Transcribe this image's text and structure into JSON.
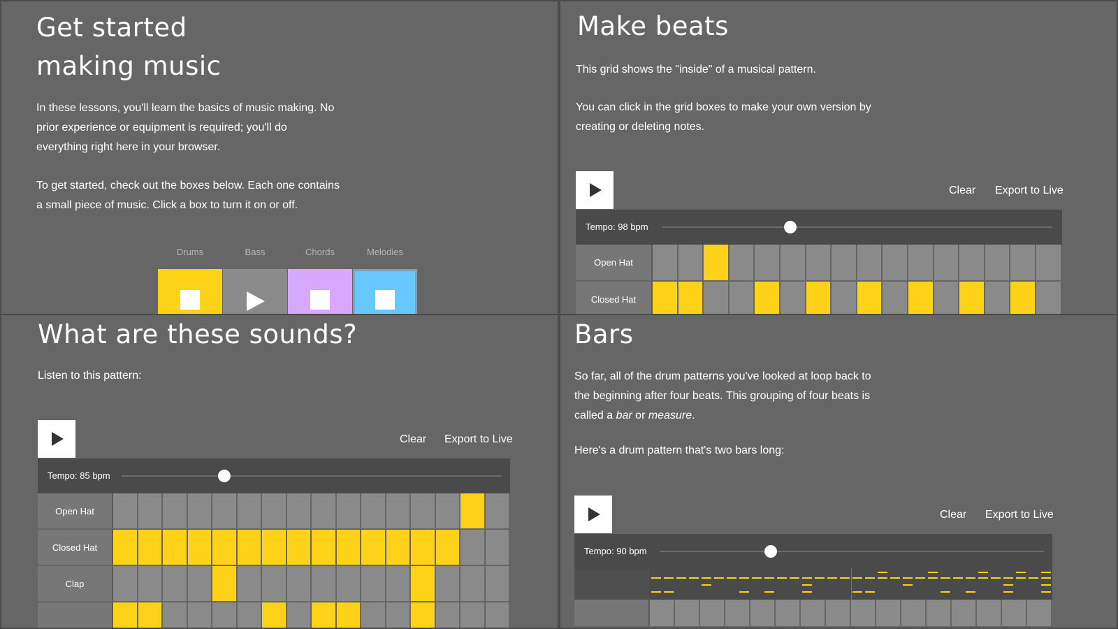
{
  "panel1": {
    "title_line1": "Get started",
    "title_line2": "making music",
    "para1_l1": "In these lessons, you'll learn the basics of music making. No",
    "para1_l2": "prior experience or equipment is required; you'll do",
    "para1_l3": "everything right here in your browser.",
    "para2_l1": "To get started, check out the boxes below. Each one contains",
    "para2_l2": "a small piece of music. Click a box to turn it on or off.",
    "instruments": [
      {
        "label": "Drums",
        "color": "#ffd21a",
        "icon": "stop-icon"
      },
      {
        "label": "Bass",
        "color": "#8a8a8a",
        "icon": "play-icon"
      },
      {
        "label": "Chords",
        "color": "#d6a8ff",
        "icon": "stop-icon"
      },
      {
        "label": "Melodies",
        "color": "#66c8ff",
        "icon": "stop-icon"
      }
    ]
  },
  "panel2": {
    "title": "Make beats",
    "para1": "This grid shows the \"inside\" of a musical pattern.",
    "para2_l1": "You can click in the grid boxes to make your own version by",
    "para2_l2": "creating or deleting notes.",
    "clear": "Clear",
    "export": "Export to Live",
    "tempo_label": "Tempo: 98 bpm",
    "tempo_bpm": 98,
    "rows": [
      {
        "label": "Open Hat",
        "cells": [
          0,
          0,
          1,
          0,
          0,
          0,
          0,
          0,
          0,
          0,
          0,
          0,
          0,
          0,
          0,
          0
        ]
      },
      {
        "label": "Closed Hat",
        "cells": [
          1,
          1,
          0,
          0,
          1,
          0,
          1,
          0,
          1,
          0,
          1,
          0,
          1,
          0,
          1,
          0
        ]
      }
    ]
  },
  "panel3": {
    "title": "What are these sounds?",
    "para1": "Listen to this pattern:",
    "clear": "Clear",
    "export": "Export to Live",
    "tempo_label": "Tempo: 85 bpm",
    "tempo_bpm": 85,
    "rows": [
      {
        "label": "Open Hat",
        "cells": [
          0,
          0,
          0,
          0,
          0,
          0,
          0,
          0,
          0,
          0,
          0,
          0,
          0,
          0,
          1,
          0
        ]
      },
      {
        "label": "Closed Hat",
        "cells": [
          1,
          1,
          1,
          1,
          1,
          1,
          1,
          1,
          1,
          1,
          1,
          1,
          1,
          1,
          0,
          0
        ]
      },
      {
        "label": "Clap",
        "cells": [
          0,
          0,
          0,
          0,
          1,
          0,
          0,
          0,
          0,
          0,
          0,
          0,
          1,
          0,
          0,
          0
        ]
      },
      {
        "label": "",
        "cells": [
          1,
          1,
          0,
          0,
          0,
          0,
          1,
          0,
          1,
          1,
          0,
          0,
          1,
          0,
          0,
          0
        ]
      }
    ]
  },
  "panel4": {
    "title": "Bars",
    "para1_l1": "So far, all of the drum patterns you've looked at loop back to",
    "para1_l2": "the beginning after four beats. This grouping of four beats is",
    "para1_l3a": "called a ",
    "para1_l3b": "bar",
    "para1_l3c": " or ",
    "para1_l3d": "measure",
    "para1_l3e": ".",
    "para2": "Here's a drum pattern that's two bars long:",
    "clear": "Clear",
    "export": "Export to Live",
    "tempo_label": "Tempo: 90 bpm",
    "tempo_bpm": 90,
    "bottom_cells": [
      0,
      0,
      0,
      0,
      0,
      0,
      0,
      0,
      0,
      0,
      0,
      0,
      0,
      0,
      0,
      0,
      0,
      0,
      0,
      0,
      0,
      0,
      0,
      0,
      0,
      0,
      0,
      0,
      0,
      0,
      0,
      0,
      0,
      0,
      0,
      0,
      0,
      0,
      0,
      0,
      1,
      0,
      0,
      0,
      0,
      0,
      0,
      0,
      0,
      1,
      0,
      0,
      0,
      0,
      0,
      0,
      1,
      0
    ]
  },
  "colors": {
    "accent": "#ffd21a",
    "panel": "#666666",
    "dark": "#4a4a4a"
  }
}
